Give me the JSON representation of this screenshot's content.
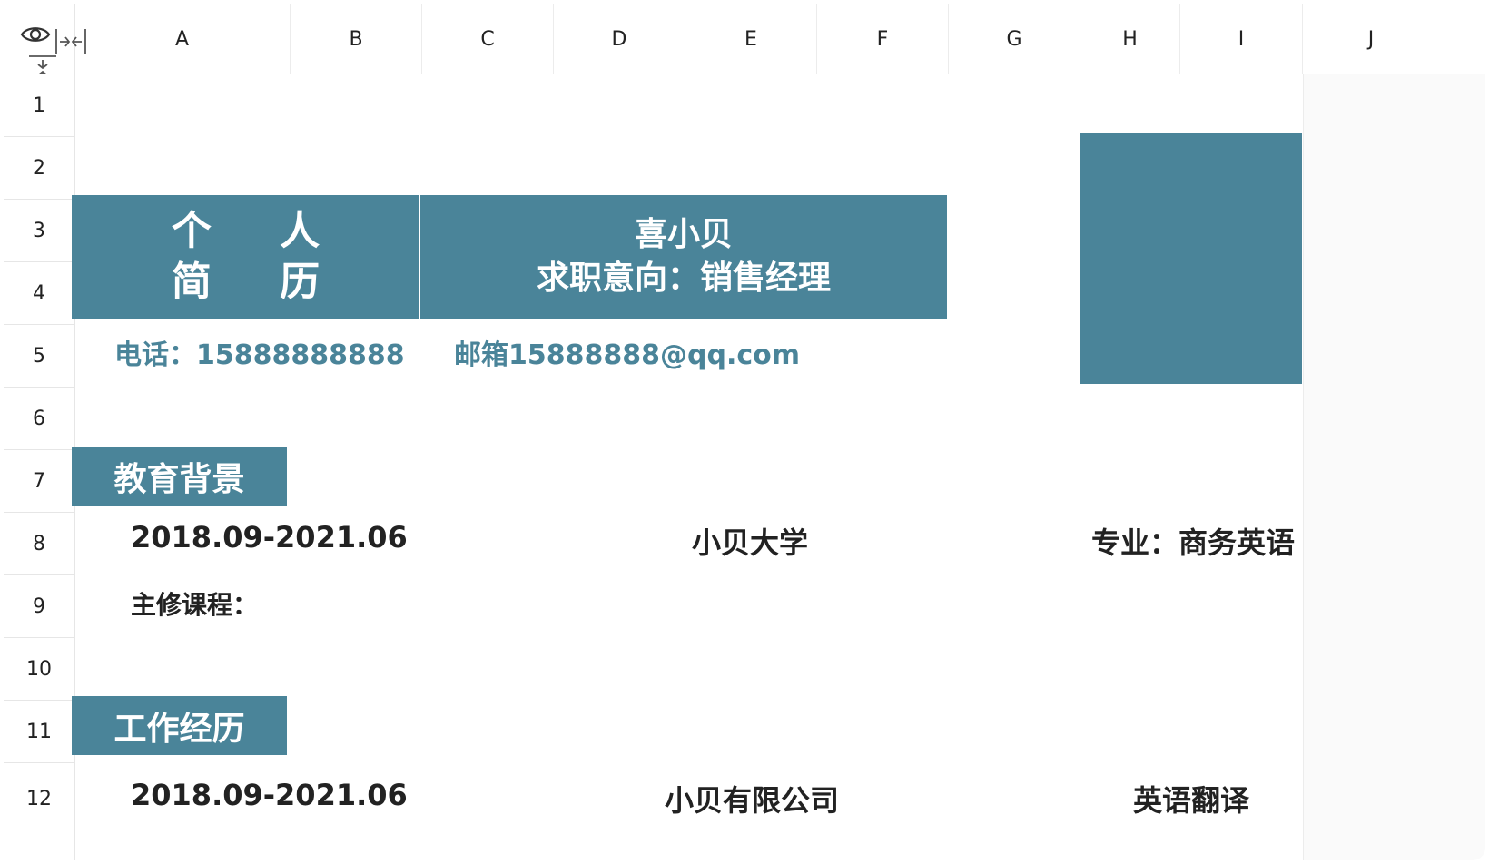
{
  "columns": [
    "A",
    "B",
    "C",
    "D",
    "E",
    "F",
    "G",
    "H",
    "I",
    "J"
  ],
  "rows": [
    "1",
    "2",
    "3",
    "4",
    "5",
    "6",
    "7",
    "8",
    "9",
    "10",
    "11",
    "12"
  ],
  "corner_icons": [
    "eye-icon",
    "collapse-columns-icon",
    "collapse-rows-icon"
  ],
  "resume": {
    "title_line1": "个 人",
    "title_line2": "简 历",
    "name": "喜小贝",
    "objective": "求职意向：销售经理",
    "phone": "电话：15888888888",
    "email": "邮箱15888888@qq.com"
  },
  "education": {
    "heading": "教育背景",
    "period": "2018.09-2021.06",
    "school": "小贝大学",
    "major": "专业：商务英语",
    "courses_label": "主修课程："
  },
  "work": {
    "heading": "工作经历",
    "period": "2018.09-2021.06",
    "company": "小贝有限公司",
    "role": "英语翻译"
  },
  "colors": {
    "accent": "#4a8499",
    "text": "#222222"
  }
}
